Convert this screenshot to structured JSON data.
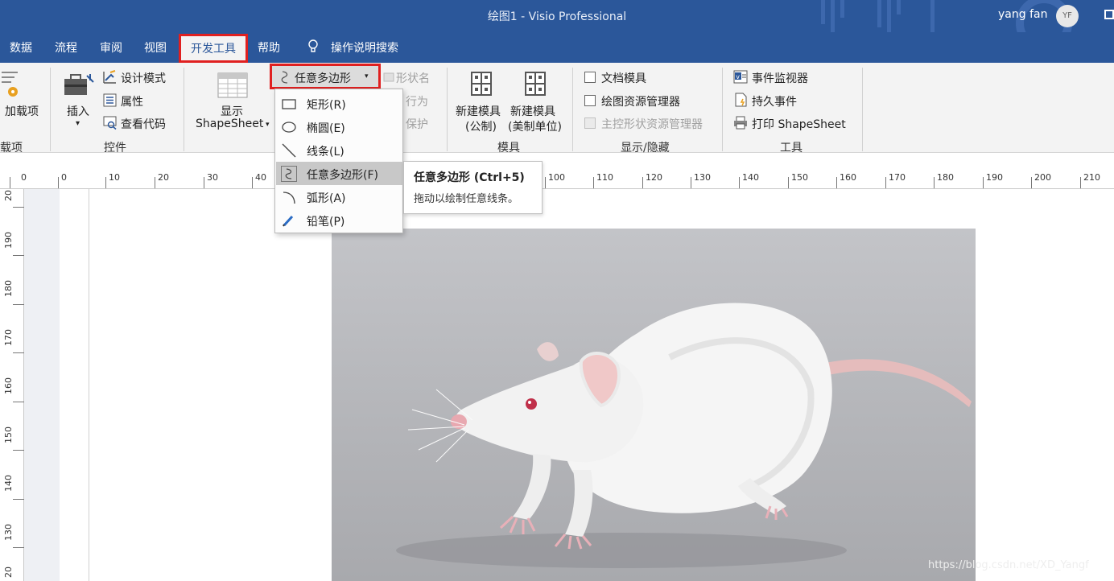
{
  "window": {
    "title": "绘图1  -  Visio Professional",
    "user_name": "yang fan",
    "user_initials": "YF"
  },
  "menu": {
    "tabs": [
      "数据",
      "流程",
      "审阅",
      "视图",
      "开发工具",
      "帮助"
    ],
    "active_tab": "开发工具",
    "search_label": "操作说明搜索"
  },
  "ribbon": {
    "addins": {
      "button": "加载项",
      "group_label": "载项"
    },
    "controls": {
      "insert_label": "插入",
      "design_mode": "设计模式",
      "properties": "属性",
      "view_code": "查看代码",
      "group_label": "控件"
    },
    "shape_design": {
      "show_label_line1": "显示",
      "show_label_line2": "ShapeSheet",
      "freeform_label": "任意多边形",
      "shape_name": "形状名",
      "behavior_partial": "行为",
      "protect_partial": "保护"
    },
    "stencil": {
      "new_metric_l1": "新建模具",
      "new_metric_l2": "(公制)",
      "new_us_l1": "新建模具",
      "new_us_l2": "(美制单位)",
      "group_label": "模具"
    },
    "show_hide": {
      "document_stencil": "文档模具",
      "drawing_explorer": "绘图资源管理器",
      "master_explorer": "主控形状资源管理器",
      "group_label": "显示/隐藏"
    },
    "tools": {
      "event_monitor": "事件监视器",
      "persistent_events": "持久事件",
      "print_shapesheet": "打印 ShapeSheet",
      "group_label": "工具"
    }
  },
  "dropdown": {
    "items": [
      {
        "label": "矩形(R)",
        "icon": "rectangle-icon"
      },
      {
        "label": "椭圆(E)",
        "icon": "ellipse-icon"
      },
      {
        "label": "线条(L)",
        "icon": "line-icon"
      },
      {
        "label": "任意多边形(F)",
        "icon": "freeform-icon",
        "highlighted": true
      },
      {
        "label": "弧形(A)",
        "icon": "arc-icon"
      },
      {
        "label": "铅笔(P)",
        "icon": "pencil-icon"
      }
    ]
  },
  "tooltip": {
    "title": "任意多边形 (Ctrl+5)",
    "description": "拖动以绘制任意线条。"
  },
  "ruler": {
    "horizontal_ticks": [
      "0",
      "0",
      "10",
      "20",
      "30",
      "40",
      "100",
      "110",
      "120",
      "130",
      "140",
      "150",
      "160",
      "170",
      "180",
      "190",
      "200",
      "210"
    ],
    "vertical_ticks": [
      "20",
      "190",
      "180",
      "170",
      "160",
      "150",
      "140",
      "130",
      "20"
    ]
  },
  "canvas": {
    "image_subject": "white-rat-photo"
  },
  "watermark": "https://blog.csdn.net/XD_Yangf"
}
